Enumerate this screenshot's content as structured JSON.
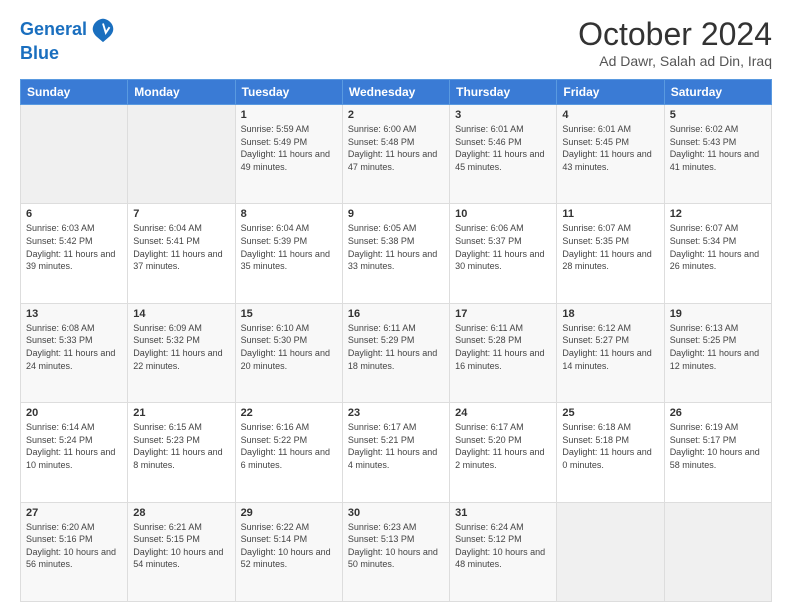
{
  "header": {
    "logo_line1": "General",
    "logo_line2": "Blue",
    "title": "October 2024",
    "subtitle": "Ad Dawr, Salah ad Din, Iraq"
  },
  "calendar": {
    "days_of_week": [
      "Sunday",
      "Monday",
      "Tuesday",
      "Wednesday",
      "Thursday",
      "Friday",
      "Saturday"
    ],
    "weeks": [
      [
        {
          "day": "",
          "info": ""
        },
        {
          "day": "",
          "info": ""
        },
        {
          "day": "1",
          "info": "Sunrise: 5:59 AM\nSunset: 5:49 PM\nDaylight: 11 hours and 49 minutes."
        },
        {
          "day": "2",
          "info": "Sunrise: 6:00 AM\nSunset: 5:48 PM\nDaylight: 11 hours and 47 minutes."
        },
        {
          "day": "3",
          "info": "Sunrise: 6:01 AM\nSunset: 5:46 PM\nDaylight: 11 hours and 45 minutes."
        },
        {
          "day": "4",
          "info": "Sunrise: 6:01 AM\nSunset: 5:45 PM\nDaylight: 11 hours and 43 minutes."
        },
        {
          "day": "5",
          "info": "Sunrise: 6:02 AM\nSunset: 5:43 PM\nDaylight: 11 hours and 41 minutes."
        }
      ],
      [
        {
          "day": "6",
          "info": "Sunrise: 6:03 AM\nSunset: 5:42 PM\nDaylight: 11 hours and 39 minutes."
        },
        {
          "day": "7",
          "info": "Sunrise: 6:04 AM\nSunset: 5:41 PM\nDaylight: 11 hours and 37 minutes."
        },
        {
          "day": "8",
          "info": "Sunrise: 6:04 AM\nSunset: 5:39 PM\nDaylight: 11 hours and 35 minutes."
        },
        {
          "day": "9",
          "info": "Sunrise: 6:05 AM\nSunset: 5:38 PM\nDaylight: 11 hours and 33 minutes."
        },
        {
          "day": "10",
          "info": "Sunrise: 6:06 AM\nSunset: 5:37 PM\nDaylight: 11 hours and 30 minutes."
        },
        {
          "day": "11",
          "info": "Sunrise: 6:07 AM\nSunset: 5:35 PM\nDaylight: 11 hours and 28 minutes."
        },
        {
          "day": "12",
          "info": "Sunrise: 6:07 AM\nSunset: 5:34 PM\nDaylight: 11 hours and 26 minutes."
        }
      ],
      [
        {
          "day": "13",
          "info": "Sunrise: 6:08 AM\nSunset: 5:33 PM\nDaylight: 11 hours and 24 minutes."
        },
        {
          "day": "14",
          "info": "Sunrise: 6:09 AM\nSunset: 5:32 PM\nDaylight: 11 hours and 22 minutes."
        },
        {
          "day": "15",
          "info": "Sunrise: 6:10 AM\nSunset: 5:30 PM\nDaylight: 11 hours and 20 minutes."
        },
        {
          "day": "16",
          "info": "Sunrise: 6:11 AM\nSunset: 5:29 PM\nDaylight: 11 hours and 18 minutes."
        },
        {
          "day": "17",
          "info": "Sunrise: 6:11 AM\nSunset: 5:28 PM\nDaylight: 11 hours and 16 minutes."
        },
        {
          "day": "18",
          "info": "Sunrise: 6:12 AM\nSunset: 5:27 PM\nDaylight: 11 hours and 14 minutes."
        },
        {
          "day": "19",
          "info": "Sunrise: 6:13 AM\nSunset: 5:25 PM\nDaylight: 11 hours and 12 minutes."
        }
      ],
      [
        {
          "day": "20",
          "info": "Sunrise: 6:14 AM\nSunset: 5:24 PM\nDaylight: 11 hours and 10 minutes."
        },
        {
          "day": "21",
          "info": "Sunrise: 6:15 AM\nSunset: 5:23 PM\nDaylight: 11 hours and 8 minutes."
        },
        {
          "day": "22",
          "info": "Sunrise: 6:16 AM\nSunset: 5:22 PM\nDaylight: 11 hours and 6 minutes."
        },
        {
          "day": "23",
          "info": "Sunrise: 6:17 AM\nSunset: 5:21 PM\nDaylight: 11 hours and 4 minutes."
        },
        {
          "day": "24",
          "info": "Sunrise: 6:17 AM\nSunset: 5:20 PM\nDaylight: 11 hours and 2 minutes."
        },
        {
          "day": "25",
          "info": "Sunrise: 6:18 AM\nSunset: 5:18 PM\nDaylight: 11 hours and 0 minutes."
        },
        {
          "day": "26",
          "info": "Sunrise: 6:19 AM\nSunset: 5:17 PM\nDaylight: 10 hours and 58 minutes."
        }
      ],
      [
        {
          "day": "27",
          "info": "Sunrise: 6:20 AM\nSunset: 5:16 PM\nDaylight: 10 hours and 56 minutes."
        },
        {
          "day": "28",
          "info": "Sunrise: 6:21 AM\nSunset: 5:15 PM\nDaylight: 10 hours and 54 minutes."
        },
        {
          "day": "29",
          "info": "Sunrise: 6:22 AM\nSunset: 5:14 PM\nDaylight: 10 hours and 52 minutes."
        },
        {
          "day": "30",
          "info": "Sunrise: 6:23 AM\nSunset: 5:13 PM\nDaylight: 10 hours and 50 minutes."
        },
        {
          "day": "31",
          "info": "Sunrise: 6:24 AM\nSunset: 5:12 PM\nDaylight: 10 hours and 48 minutes."
        },
        {
          "day": "",
          "info": ""
        },
        {
          "day": "",
          "info": ""
        }
      ]
    ]
  }
}
